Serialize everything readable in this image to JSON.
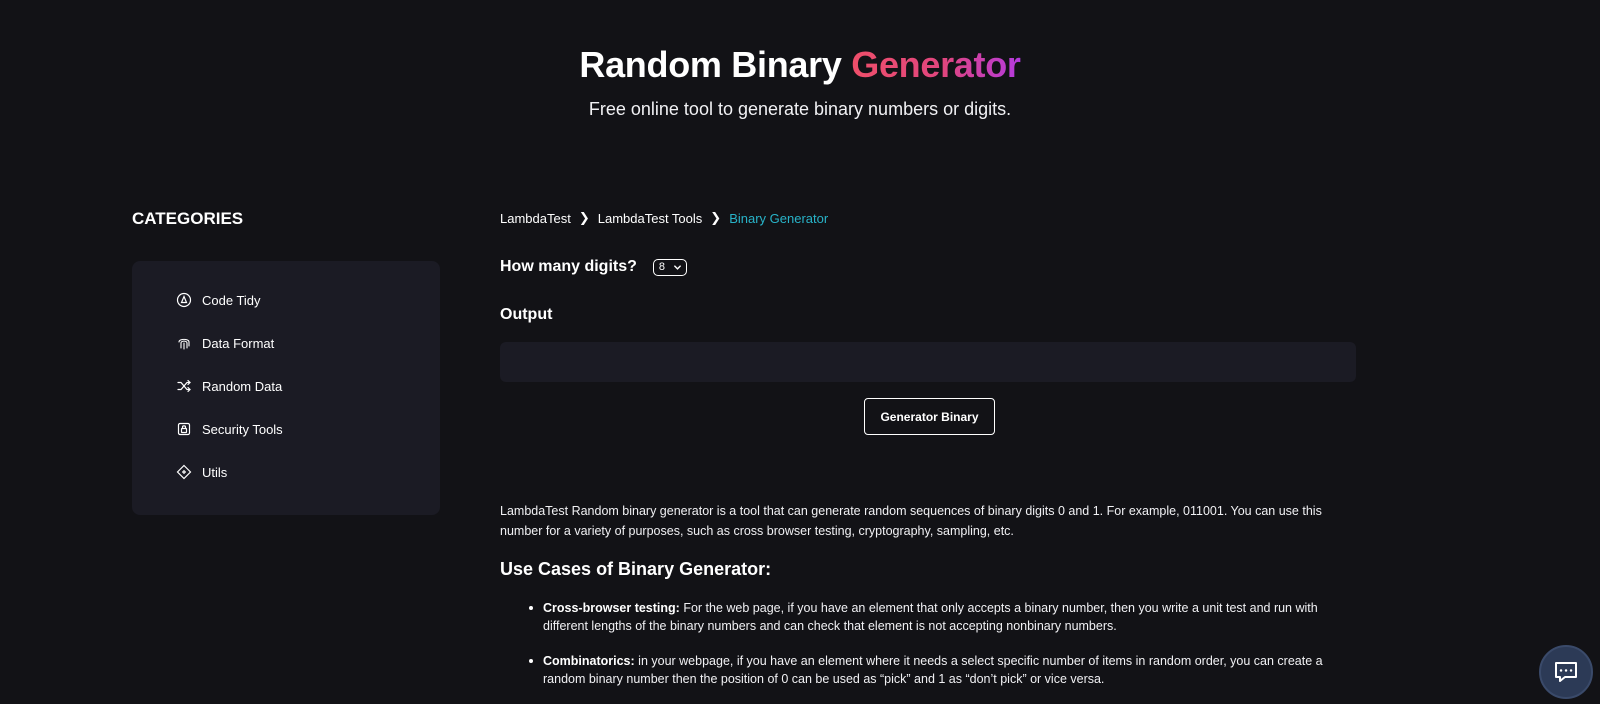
{
  "hero": {
    "title_main": "Random Binary",
    "title_accent": "Generator",
    "subtitle": "Free online tool to generate binary numbers or digits."
  },
  "sidebar": {
    "title": "CATEGORIES",
    "items": [
      {
        "label": "Code Tidy",
        "icon": "code-tidy-icon"
      },
      {
        "label": "Data Format",
        "icon": "fingerprint-icon"
      },
      {
        "label": "Random Data",
        "icon": "shuffle-icon"
      },
      {
        "label": "Security Tools",
        "icon": "lock-icon"
      },
      {
        "label": "Utils",
        "icon": "utils-icon"
      }
    ]
  },
  "breadcrumb": {
    "items": [
      "LambdaTest",
      "LambdaTest Tools",
      "Binary Generator"
    ]
  },
  "form": {
    "digits_label": "How many digits?",
    "digits_value": "8",
    "output_label": "Output",
    "output_value": "",
    "generate_label": "Generator Binary"
  },
  "content": {
    "description": "LambdaTest Random binary generator is a tool that can generate random sequences of binary digits 0 and 1. For example, 011001. You can use this number for a variety of purposes, such as cross browser testing, cryptography, sampling, etc.",
    "uses_title": "Use Cases of Binary Generator:",
    "uses": [
      {
        "term": "Cross-browser testing:",
        "text": " For the web page, if you have an element that only accepts a binary number, then you write a unit test and run with different lengths of the binary numbers and can check that element is not accepting nonbinary numbers."
      },
      {
        "term": "Combinatorics:",
        "text": " in your webpage, if you have an element where it needs a select specific number of items in random order, you can create a random binary number then the position of 0 can be used as “pick” and 1 as “don’t pick” or vice versa."
      }
    ]
  },
  "colors": {
    "background": "#121216",
    "panel": "#1b1b24",
    "accent_start": "#ef4f6a",
    "accent_end": "#b43ae0",
    "breadcrumb_current": "#28b3c8"
  },
  "chat": {
    "icon": "chat-icon"
  }
}
